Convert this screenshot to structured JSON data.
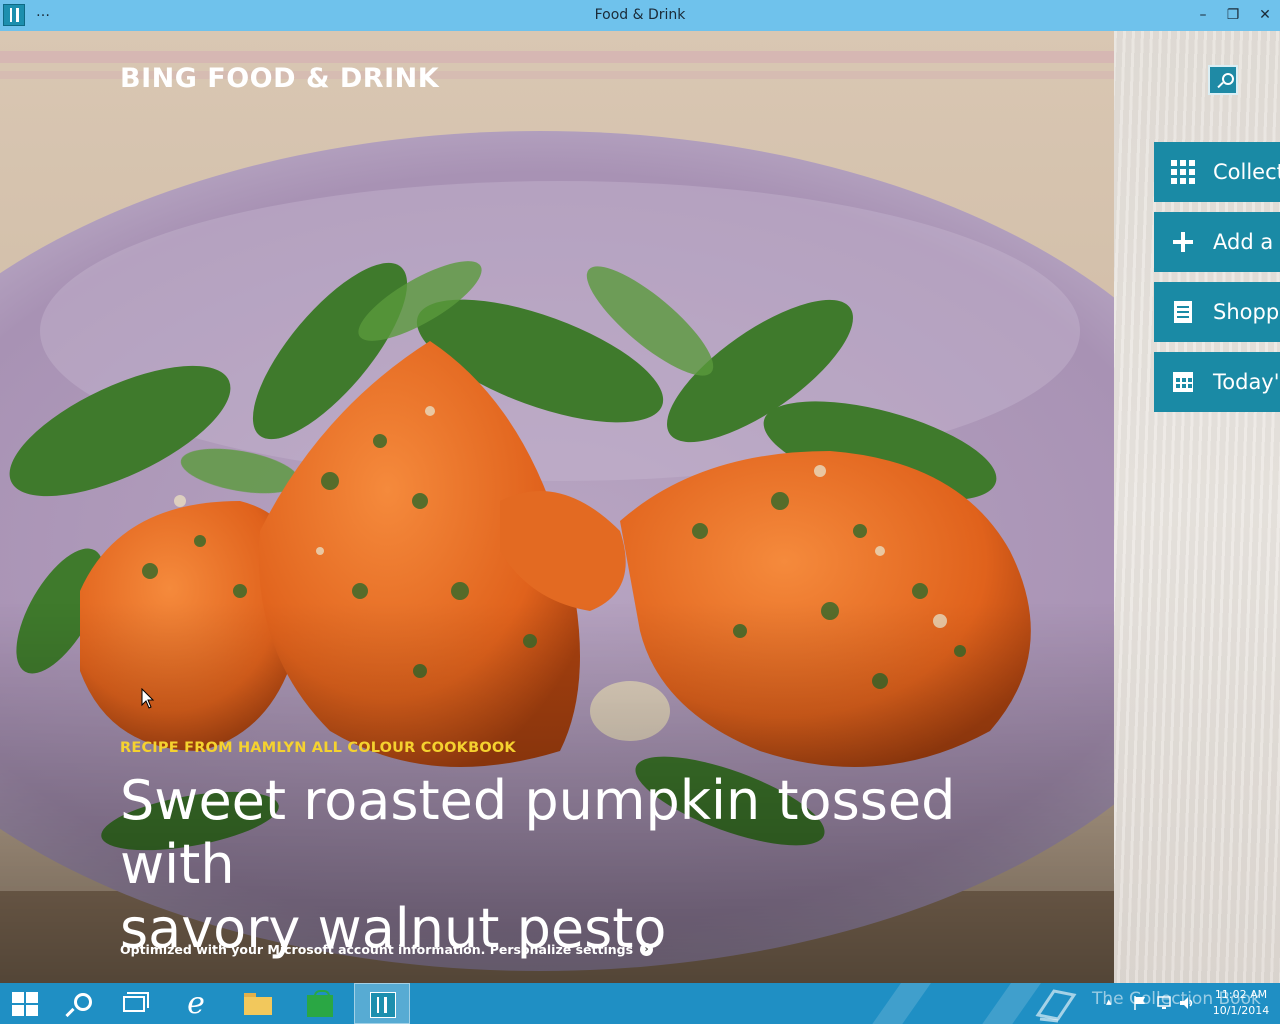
{
  "window": {
    "title": "Food & Drink",
    "menu": "…",
    "minimize": "–",
    "maximize": "❐",
    "close": "✕"
  },
  "hero": {
    "brand": "BING FOOD & DRINK",
    "source": "RECIPE FROM HAMLYN ALL COLOUR COOKBOOK",
    "headline_line1": "Sweet roasted pumpkin tossed with",
    "headline_line2": "savory walnut pesto",
    "optimized": "Optimized with your Microsoft account information. Personalize settings",
    "optimized_arrow": "›"
  },
  "side": {
    "search_icon": "search-icon",
    "items": [
      {
        "label": "Collections",
        "icon": "grid-icon"
      },
      {
        "label": "Add a recipe",
        "icon": "plus-icon"
      },
      {
        "label": "Shopping list",
        "icon": "clipboard-icon"
      },
      {
        "label": "Today's menu",
        "icon": "calendar-icon"
      }
    ]
  },
  "taskbar": {
    "watermark": "The Collection Book",
    "time": "11:02 AM",
    "date": "10/1/2014",
    "ie_glyph": "e",
    "tray_up": "▴"
  },
  "colors": {
    "titlebar": "#6fc2ec",
    "accent": "#1a8aa5",
    "taskbar": "#1f8fc4",
    "source_yellow": "#f5d22f"
  }
}
